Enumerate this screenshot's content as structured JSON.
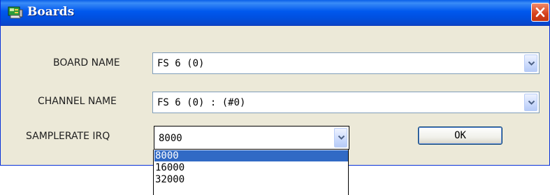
{
  "window": {
    "title": "Boards",
    "icon": "boards-window-icon",
    "close_icon": "close-icon"
  },
  "fields": {
    "board_name": {
      "label": "BOARD NAME",
      "value": "FS 6 (0)"
    },
    "channel_name": {
      "label": "CHANNEL NAME",
      "value": "FS 6 (0) : (#0)"
    },
    "samplerate_irq": {
      "label": "SAMPLERATE IRQ",
      "value": "8000"
    }
  },
  "ok_button": {
    "label": "OK"
  },
  "samplerate_options": [
    "8000",
    "16000",
    "32000"
  ],
  "colors": {
    "title_bar": "#0058ee",
    "dialog_bg": "#ece9d8",
    "selection": "#316ac5",
    "close_button": "#d6411c"
  }
}
